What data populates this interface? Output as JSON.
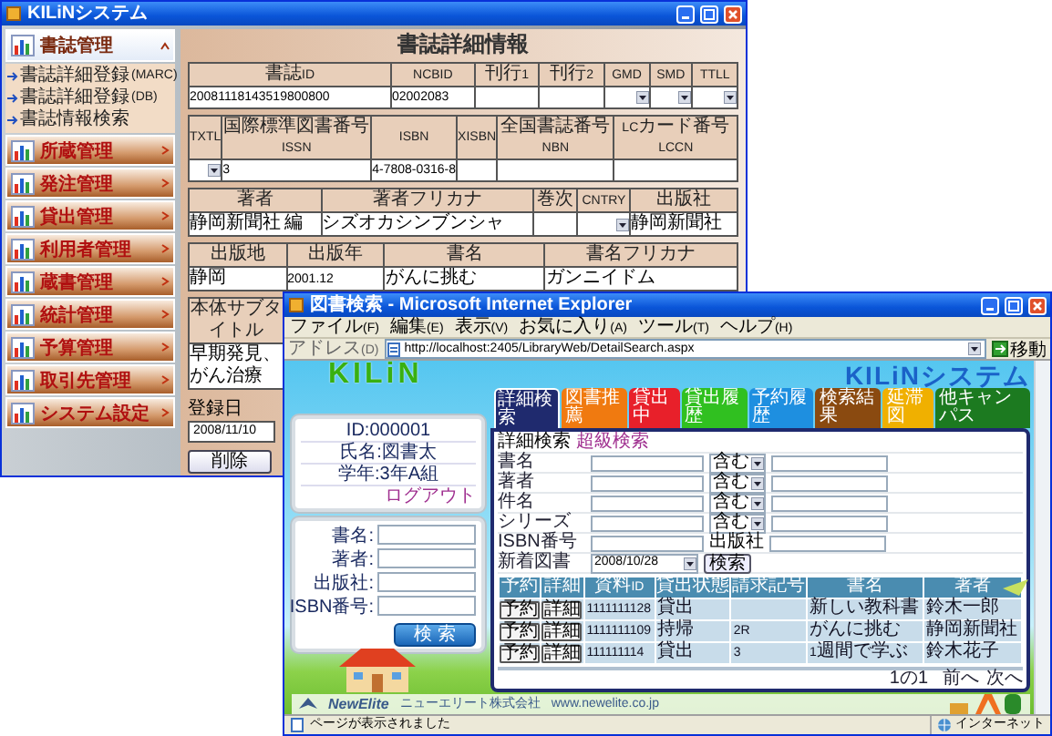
{
  "library_window": {
    "title": "KILiNシステム",
    "sidebar": [
      {
        "label": "書誌管理",
        "expanded": true,
        "children": [
          {
            "label": "書誌詳細登録(MARC)"
          },
          {
            "label": "書誌詳細登録(DB)"
          },
          {
            "label": "書誌情報検索"
          }
        ]
      },
      {
        "label": "所蔵管理",
        "expanded": false
      },
      {
        "label": "発注管理",
        "expanded": false
      },
      {
        "label": "貸出管理",
        "expanded": false
      },
      {
        "label": "利用者管理",
        "expanded": false
      },
      {
        "label": "蔵書管理",
        "expanded": false
      },
      {
        "label": "統計管理",
        "expanded": false
      },
      {
        "label": "予算管理",
        "expanded": false
      },
      {
        "label": "取引先管理",
        "expanded": false
      },
      {
        "label": "システム設定",
        "expanded": false
      }
    ],
    "detail": {
      "title": "書誌詳細情報",
      "groups": [
        {
          "columns": [
            "書誌ID",
            "NCBID",
            "刊行1",
            "刊行2",
            "GMD",
            "SMD",
            "TTLL"
          ],
          "cells": [
            {
              "kind": "text",
              "value": "20081118143519800800"
            },
            {
              "kind": "text",
              "value": "02002083"
            },
            {
              "kind": "input"
            },
            {
              "kind": "input"
            },
            {
              "kind": "select"
            },
            {
              "kind": "select"
            },
            {
              "kind": "select"
            }
          ]
        },
        {
          "columns": [
            "TXTL",
            "国際標準図書番号ISSN",
            "ISBN",
            "XISBN",
            "全国書誌番号NBN",
            "LCカード番号LCCN"
          ],
          "cells": [
            {
              "kind": "select"
            },
            {
              "kind": "text",
              "value": "3"
            },
            {
              "kind": "text",
              "value": "4-7808-0316-8"
            },
            {
              "kind": "input"
            },
            {
              "kind": "input"
            },
            {
              "kind": "input"
            }
          ]
        },
        {
          "columns": [
            "著者",
            "著者フリカナ",
            "巻次",
            "CNTRY",
            "出版社"
          ],
          "cells": [
            {
              "kind": "text",
              "value": "静岡新聞社 編"
            },
            {
              "kind": "text",
              "value": "シズオカシンブンシャ"
            },
            {
              "kind": "input"
            },
            {
              "kind": "select"
            },
            {
              "kind": "text",
              "value": "静岡新聞社"
            }
          ]
        },
        {
          "columns": [
            "出版地",
            "出版年",
            "書名",
            "書名フリカナ"
          ],
          "cells": [
            {
              "kind": "text",
              "value": "静岡"
            },
            {
              "kind": "text",
              "value": "2001.12"
            },
            {
              "kind": "text",
              "value": "がんに挑む"
            },
            {
              "kind": "text",
              "value": "ガンニイドム"
            }
          ]
        },
        {
          "columns": [
            "本体サブタイトル"
          ],
          "cells": [
            {
              "kind": "text",
              "value": "早期発見、がん治療"
            }
          ]
        }
      ],
      "registered_label": "登録日",
      "registered_value": "2008/11/10",
      "delete_button": "削除"
    }
  },
  "browser_window": {
    "title": "図書検索 - Microsoft Internet Explorer",
    "menu": [
      "ファイル(F)",
      "編集(E)",
      "表示(V)",
      "お気に入り(A)",
      "ツール(T)",
      "ヘルプ(H)"
    ],
    "address_label": "アドレス(D)",
    "url": "http://localhost:2405/LibraryWeb/DetailSearch.aspx",
    "go_button": "移動",
    "logo": "KILiN",
    "system_title": "KILiNシステム",
    "user_info": [
      "ID:000001",
      "氏名:図書太",
      "学年:3年A組"
    ],
    "logout": "ログアウト",
    "quick_search": {
      "fields": [
        {
          "label": "書名:"
        },
        {
          "label": "著者:"
        },
        {
          "label": "出版社:"
        },
        {
          "label": "ISBN番号:"
        }
      ],
      "button": "検 索"
    },
    "tabs": [
      {
        "label": "詳細検索",
        "color": "#1f2a6e",
        "selected": true
      },
      {
        "label": "図書推薦",
        "color": "#f07a10",
        "selected": false
      },
      {
        "label": "貸出中",
        "color": "#e8202a",
        "selected": false
      },
      {
        "label": "貸出履歴",
        "color": "#30c020",
        "selected": false
      },
      {
        "label": "予約履歴",
        "color": "#1e8fe0",
        "selected": false
      },
      {
        "label": "検索結果",
        "color": "#8a4a10",
        "selected": false
      },
      {
        "label": "延滞図",
        "color": "#f0b000",
        "selected": false
      },
      {
        "label": "他キャンパス",
        "color": "#1c7a20",
        "selected": false
      }
    ],
    "search_form": {
      "title": "詳細検索",
      "link": "超級検索",
      "rows": [
        {
          "label": "書名",
          "match": "含む"
        },
        {
          "label": "著者",
          "match": "含む"
        },
        {
          "label": "件名",
          "match": "含む"
        },
        {
          "label": "シリーズ",
          "match": "含む"
        },
        {
          "label": "ISBN番号",
          "extra_label": "出版社"
        }
      ],
      "date_label": "新着図書",
      "date_value": "2008/10/28",
      "search_button": "検索"
    },
    "results": {
      "columns": [
        "予約",
        "詳細",
        "資料ID",
        "貸出状態",
        "請求記号",
        "書名",
        "著者"
      ],
      "rows": [
        {
          "cells": [
            {
              "kind": "button",
              "text": "予約"
            },
            {
              "kind": "button",
              "text": "詳細"
            },
            {
              "kind": "text",
              "text": "1111111128"
            },
            {
              "kind": "text",
              "text": "貸出"
            },
            {
              "kind": "blank"
            },
            {
              "kind": "text",
              "text": "新しい教科書"
            },
            {
              "kind": "text",
              "text": "鈴木一郎"
            }
          ]
        },
        {
          "cells": [
            {
              "kind": "button",
              "text": "予約"
            },
            {
              "kind": "button",
              "text": "詳細"
            },
            {
              "kind": "text",
              "text": "1111111109"
            },
            {
              "kind": "text",
              "text": "持帰"
            },
            {
              "kind": "text",
              "text": "2R"
            },
            {
              "kind": "text",
              "text": "がんに挑む"
            },
            {
              "kind": "text",
              "text": "静岡新聞社"
            }
          ]
        },
        {
          "cells": [
            {
              "kind": "button",
              "text": "予約"
            },
            {
              "kind": "button",
              "text": "詳細"
            },
            {
              "kind": "text",
              "text": "111111114"
            },
            {
              "kind": "text",
              "text": "貸出"
            },
            {
              "kind": "text",
              "text": "3"
            },
            {
              "kind": "text",
              "text": "1週間で学ぶ"
            },
            {
              "kind": "text",
              "text": "鈴木花子"
            }
          ]
        }
      ]
    },
    "pager": "1の1",
    "prev": "前へ",
    "next": "次へ",
    "footer_brand": "NewElite",
    "footer_company": "ニューエリート株式会社",
    "footer_url": "www.newelite.co.jp",
    "status": "ページが表示されました",
    "zone": "インターネット"
  }
}
